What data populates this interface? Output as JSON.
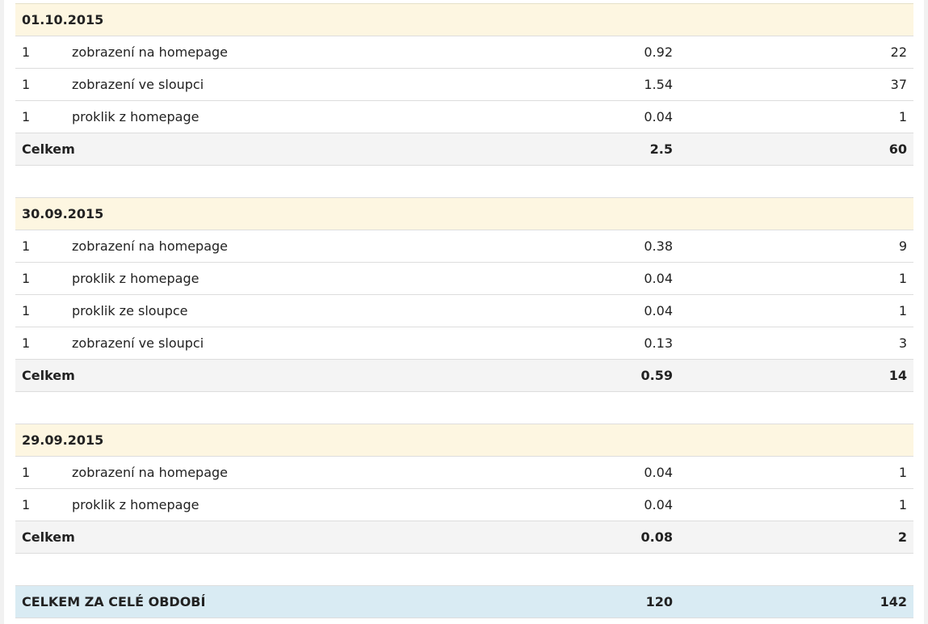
{
  "groups": [
    {
      "date": "01.10.2015",
      "rows": [
        {
          "count": "1",
          "label": "zobrazení na homepage",
          "price": "0.92",
          "total": "22"
        },
        {
          "count": "1",
          "label": "zobrazení ve sloupci",
          "price": "1.54",
          "total": "37"
        },
        {
          "count": "1",
          "label": "proklik z homepage",
          "price": "0.04",
          "total": "1"
        }
      ],
      "sum": {
        "label": "Celkem",
        "price": "2.5",
        "total": "60"
      }
    },
    {
      "date": "30.09.2015",
      "rows": [
        {
          "count": "1",
          "label": "zobrazení na homepage",
          "price": "0.38",
          "total": "9"
        },
        {
          "count": "1",
          "label": "proklik z homepage",
          "price": "0.04",
          "total": "1"
        },
        {
          "count": "1",
          "label": "proklik ze sloupce",
          "price": "0.04",
          "total": "1"
        },
        {
          "count": "1",
          "label": "zobrazení ve sloupci",
          "price": "0.13",
          "total": "3"
        }
      ],
      "sum": {
        "label": "Celkem",
        "price": "0.59",
        "total": "14"
      }
    },
    {
      "date": "29.09.2015",
      "rows": [
        {
          "count": "1",
          "label": "zobrazení na homepage",
          "price": "0.04",
          "total": "1"
        },
        {
          "count": "1",
          "label": "proklik z homepage",
          "price": "0.04",
          "total": "1"
        }
      ],
      "sum": {
        "label": "Celkem",
        "price": "0.08",
        "total": "2"
      }
    }
  ],
  "grand_total": {
    "label": "CELKEM ZA CELÉ OBDOBÍ",
    "price": "120",
    "total": "142"
  }
}
